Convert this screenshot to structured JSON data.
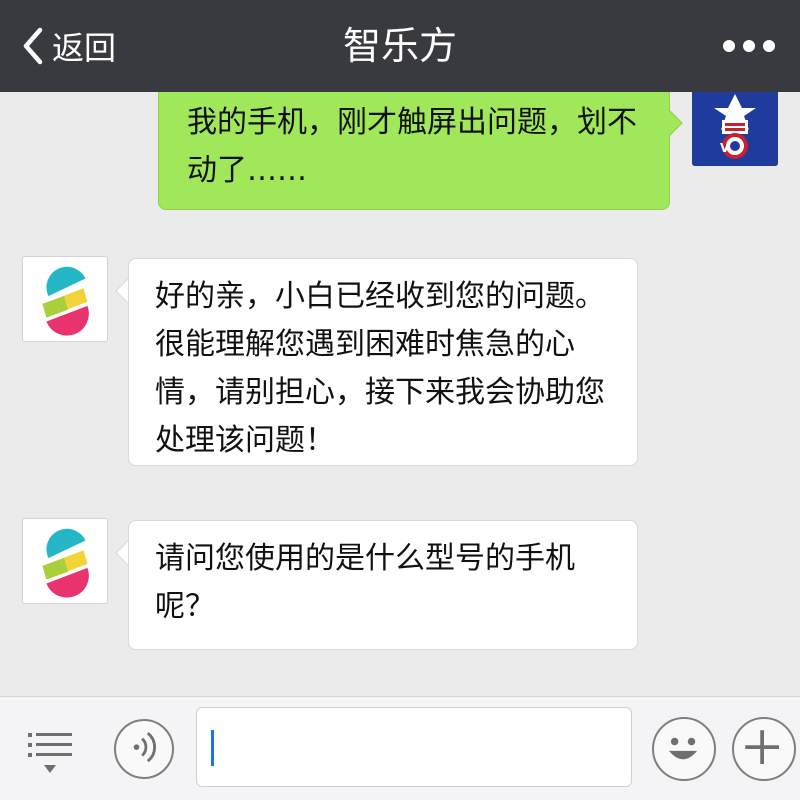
{
  "header": {
    "back_label": "返回",
    "title": "智乐方"
  },
  "messages": [
    {
      "from": "user",
      "text": "我的手机，刚才触屏出问题，划不动了……"
    },
    {
      "from": "bot",
      "text": "好的亲，小白已经收到您的问题。很能理解您遇到困难时焦急的心情，请别担心，接下来我会协助您处理该问题！"
    },
    {
      "from": "bot",
      "text": "请问您使用的是什么型号的手机呢？"
    }
  ],
  "input": {
    "value": ""
  },
  "icons": {
    "back": "chevron-left-icon",
    "more": "more-dots-icon",
    "menu": "menu-list-icon",
    "voice": "voice-icon",
    "emoji": "emoji-icon",
    "plus": "plus-icon"
  },
  "colors": {
    "header_bg": "#393a3f",
    "chat_bg": "#ebebeb",
    "outgoing_bubble": "#a0e75a",
    "incoming_bubble": "#ffffff",
    "user_avatar": "#1f3b9d",
    "caret": "#1a73e8"
  }
}
